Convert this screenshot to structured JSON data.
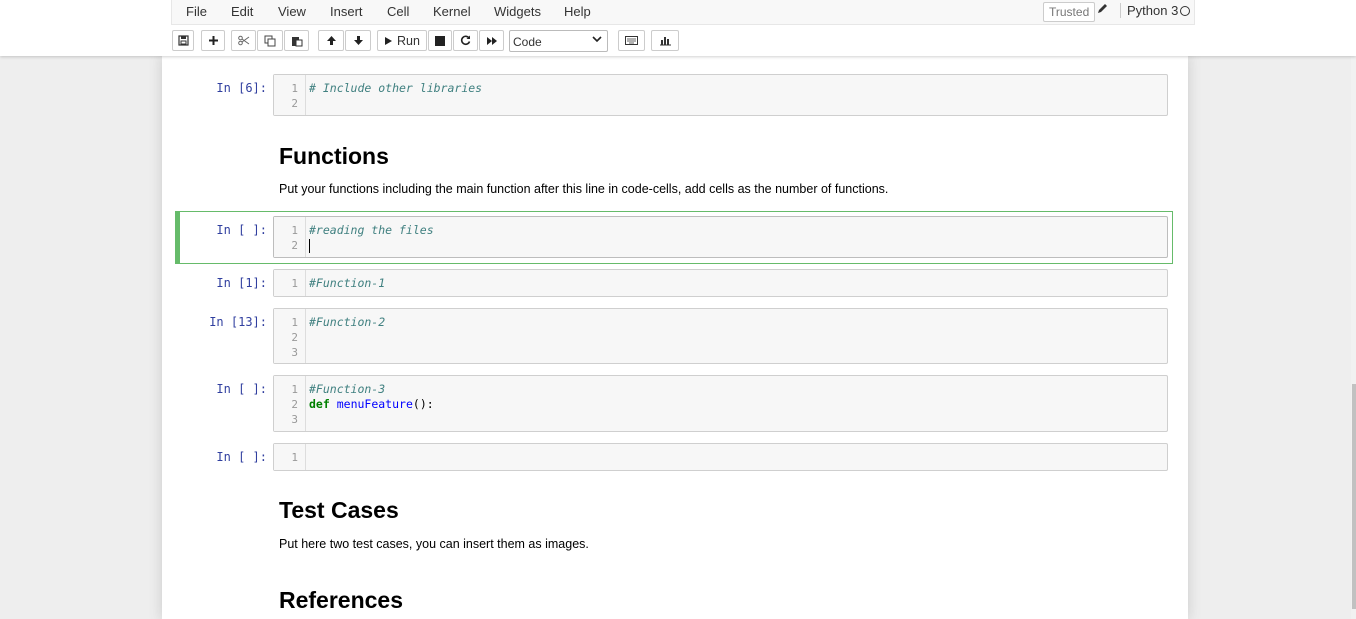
{
  "menu": [
    "File",
    "Edit",
    "View",
    "Insert",
    "Cell",
    "Kernel",
    "Widgets",
    "Help"
  ],
  "status": {
    "trusted": "Trusted",
    "kernel": "Python 3"
  },
  "toolbar": {
    "run_label": "Run",
    "cell_type": "Code"
  },
  "cells": [
    {
      "prompt": "In [6]:",
      "lines": [
        "1",
        "2"
      ],
      "code": [
        "# Include other libraries",
        ""
      ]
    },
    {
      "prompt": "In [ ]:",
      "lines": [
        "1",
        "2"
      ],
      "code": [
        "#reading the files",
        ""
      ],
      "selected": true
    },
    {
      "prompt": "In [1]:",
      "lines": [
        "1"
      ],
      "code": [
        "#Function-1"
      ]
    },
    {
      "prompt": "In [13]:",
      "lines": [
        "1",
        "2",
        "3"
      ],
      "code": [
        "#Function-2",
        "",
        ""
      ]
    },
    {
      "prompt": "In [ ]:",
      "lines": [
        "1",
        "2",
        "3"
      ],
      "code": [
        "#Function-3",
        "def menuFeature():",
        ""
      ]
    },
    {
      "prompt": "In [ ]:",
      "lines": [
        "1"
      ],
      "code": [
        ""
      ]
    }
  ],
  "code_tokens": {
    "def": "def",
    "fn_name": "menuFeature",
    "fn_rest": "():"
  },
  "markdown": {
    "functions_heading": "Functions",
    "functions_text": "Put your functions including the main function after this line in code-cells, add cells as the number of functions.",
    "tests_heading": "Test Cases",
    "tests_text": "Put here two test cases, you can insert them as images.",
    "refs_heading": "References"
  },
  "icons": {
    "save": "save-icon",
    "add": "plus-icon",
    "cut": "scissors-icon",
    "copy": "copy-icon",
    "paste": "paste-icon",
    "up": "arrow-up-icon",
    "down": "arrow-down-icon",
    "run": "play-icon",
    "stop": "stop-icon",
    "restart": "restart-icon",
    "fast_forward": "fast-forward-icon",
    "keyboard": "keyboard-icon",
    "chart": "bar-chart-icon",
    "edit": "pencil-icon",
    "kernel_idle": "circle-icon"
  },
  "colors": {
    "selected_cell_border": "#66bb6a",
    "prompt": "#303f9f",
    "comment": "#408080",
    "keyword": "#008000"
  }
}
